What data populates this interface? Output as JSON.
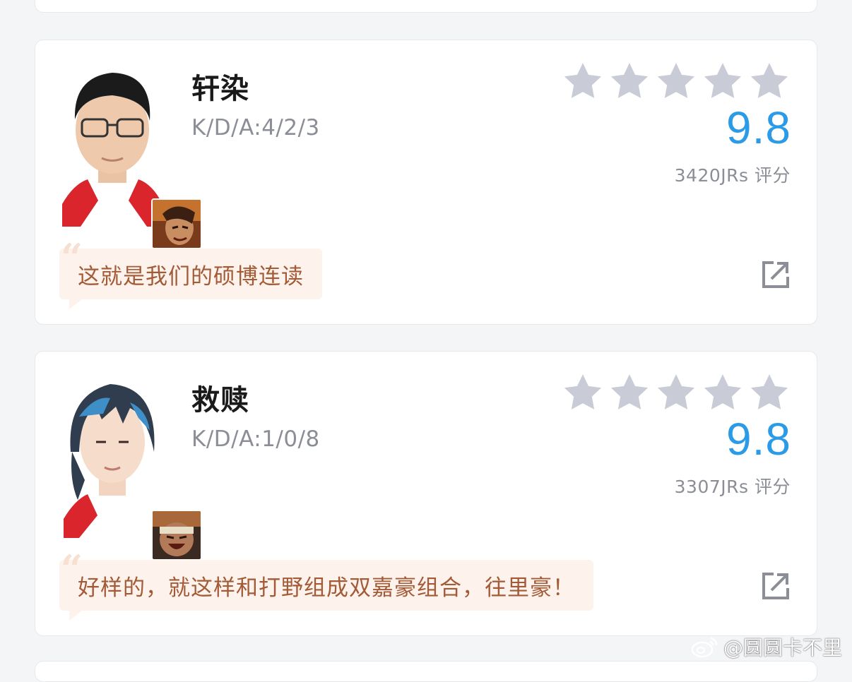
{
  "cards": [
    {
      "name": "轩染",
      "kda": "K/D/A:4/2/3",
      "stars": 5,
      "score": "9.8",
      "raters": "3420JRs 评分",
      "comment": "这就是我们的硕博连读"
    },
    {
      "name": "救赎",
      "kda": "K/D/A:1/0/8",
      "stars": 5,
      "score": "9.8",
      "raters": "3307JRs 评分",
      "comment": "好样的，就这样和打野组成双嘉豪组合，往里豪！"
    }
  ],
  "watermark": {
    "text": "@圆圆卡不里",
    "icon": "weibo-icon"
  },
  "colors": {
    "score": "#2b9be8",
    "star": "#c9ccd6",
    "comment_bg": "#fdf3ec",
    "comment_text": "#a35a36",
    "muted_text": "#8b8e96"
  },
  "icons": {
    "share": "share-external-icon",
    "star": "star-icon"
  }
}
